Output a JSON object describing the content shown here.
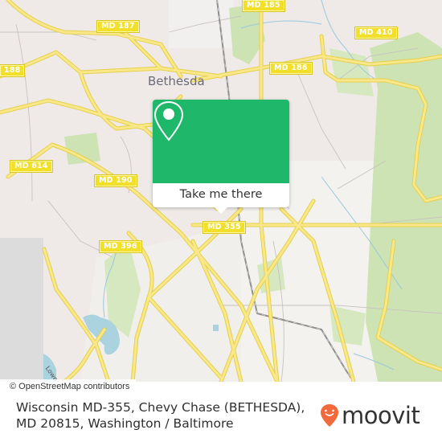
{
  "map": {
    "city_label": "Bethesda",
    "road_shields": [
      {
        "id": "md-185",
        "label": "MD 185"
      },
      {
        "id": "md-187",
        "label": "MD 187"
      },
      {
        "id": "md-410",
        "label": "MD 410"
      },
      {
        "id": "md-186",
        "label": "MD 186"
      },
      {
        "id": "md-188",
        "label": "188"
      },
      {
        "id": "md-614",
        "label": "MD 614"
      },
      {
        "id": "md-190",
        "label": "MD 190"
      },
      {
        "id": "md-355",
        "label": "MD 355"
      },
      {
        "id": "md-396",
        "label": "MD 396"
      }
    ],
    "minor_road_label": "Lowe",
    "attribution": "© OpenStreetMap contributors",
    "colors": {
      "land": "#efeae7",
      "park": "#cde3b4",
      "water": "#aad3df",
      "major_road": "#f7e06a",
      "accent_green": "#1fb86b"
    }
  },
  "popup": {
    "icon": "map-pin-icon",
    "button_label": "Take me there"
  },
  "footer": {
    "address": "Wisconsin MD-355, Chevy Chase (BETHESDA), MD 20815, Washington / Baltimore",
    "logo_text": "moovit",
    "logo_icon": "moovit-pin-icon",
    "logo_color": "#f26a3c"
  }
}
